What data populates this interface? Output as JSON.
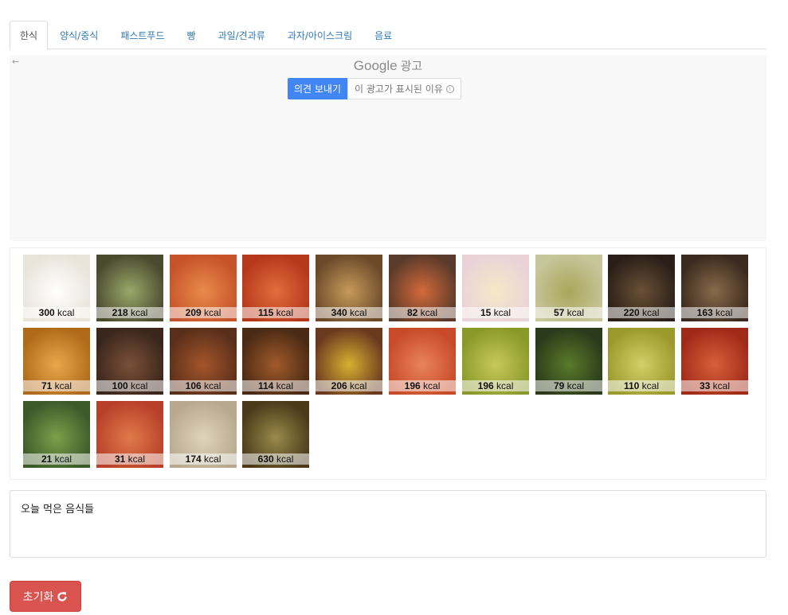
{
  "tabs": [
    {
      "label": "한식",
      "active": true
    },
    {
      "label": "양식/중식"
    },
    {
      "label": "패스트푸드"
    },
    {
      "label": "빵"
    },
    {
      "label": "과일/견과류"
    },
    {
      "label": "과자/아이스크림"
    },
    {
      "label": "음료"
    }
  ],
  "ad": {
    "back_icon": "←",
    "brand": "Google",
    "brand_suffix": "광고",
    "feedback_label": "의견 보내기",
    "why_label": "이 광고가 표시된 이유",
    "info_icon": "info-icon"
  },
  "foods": [
    {
      "kcal": "300",
      "c1": "#e9e4da",
      "c2": "#ffffff"
    },
    {
      "kcal": "218",
      "c1": "#4a4a2f",
      "c2": "#9aa86a"
    },
    {
      "kcal": "209",
      "c1": "#c7532a",
      "c2": "#e88b4a"
    },
    {
      "kcal": "115",
      "c1": "#b5371c",
      "c2": "#e46d3b"
    },
    {
      "kcal": "340",
      "c1": "#6b4a2a",
      "c2": "#c79a5a"
    },
    {
      "kcal": "82",
      "c1": "#5a3a2a",
      "c2": "#d36a3a"
    },
    {
      "kcal": "15",
      "c1": "#e9d3d8",
      "c2": "#f5e8c8"
    },
    {
      "kcal": "57",
      "c1": "#c7c59a",
      "c2": "#a8a75a"
    },
    {
      "kcal": "220",
      "c1": "#2a1f18",
      "c2": "#6a5036"
    },
    {
      "kcal": "163",
      "c1": "#3a2a1f",
      "c2": "#8a6a4a"
    },
    {
      "kcal": "71",
      "c1": "#b06a1a",
      "c2": "#e8a84a"
    },
    {
      "kcal": "100",
      "c1": "#3a261c",
      "c2": "#7a5038"
    },
    {
      "kcal": "106",
      "c1": "#5a2f1a",
      "c2": "#a4552a"
    },
    {
      "kcal": "114",
      "c1": "#4a2a14",
      "c2": "#a05a2a"
    },
    {
      "kcal": "206",
      "c1": "#6a3a1f",
      "c2": "#d8b030"
    },
    {
      "kcal": "196",
      "c1": "#c84a28",
      "c2": "#e8845a"
    },
    {
      "kcal": "196",
      "c1": "#8a9a2a",
      "c2": "#c8c85a"
    },
    {
      "kcal": "79",
      "c1": "#2a3a1a",
      "c2": "#5a7a2a"
    },
    {
      "kcal": "110",
      "c1": "#9a9a2a",
      "c2": "#d4cf6a"
    },
    {
      "kcal": "33",
      "c1": "#a02a18",
      "c2": "#d8603a"
    },
    {
      "kcal": "21",
      "c1": "#3a5a2a",
      "c2": "#7aa04a"
    },
    {
      "kcal": "31",
      "c1": "#b8402a",
      "c2": "#e07a4a"
    },
    {
      "kcal": "174",
      "c1": "#b8a890",
      "c2": "#e0d4bc"
    },
    {
      "kcal": "630",
      "c1": "#4a3a1a",
      "c2": "#9a8a4a"
    }
  ],
  "kcal_unit": "kcal",
  "eaten": {
    "title": "오늘 먹은 음식들"
  },
  "reset": {
    "label": "초기화",
    "icon": "refresh-icon"
  },
  "colors": {
    "accent_blue": "#4285f4",
    "danger": "#d9534f",
    "link": "#337ab7"
  }
}
